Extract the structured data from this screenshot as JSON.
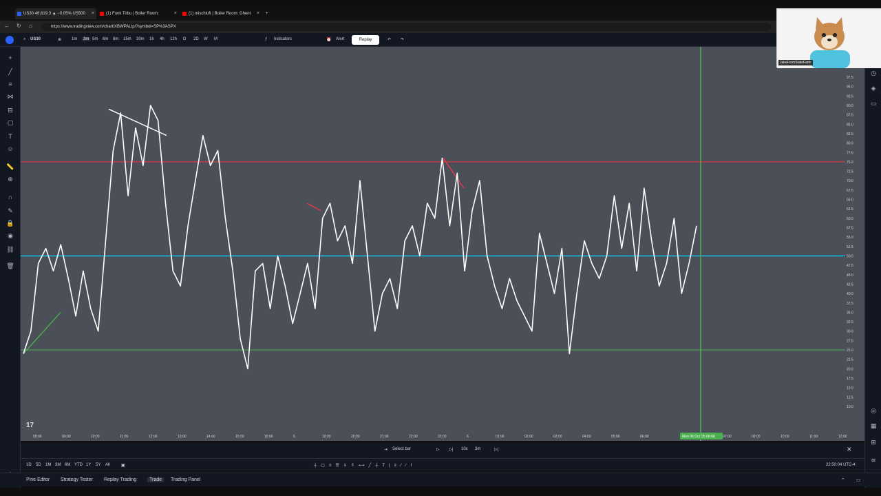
{
  "browser": {
    "tabs": [
      {
        "title": "US30 46,619.3 ▲ −0.05% US500",
        "color": "#2962ff",
        "active": true
      },
      {
        "title": "(1) Funk Tribu | Boiler Room:",
        "color": "#ff0000",
        "active": false
      },
      {
        "title": "(1) mischluft | Boiler Room: Ghent",
        "color": "#ff0000",
        "active": false
      }
    ],
    "new_tab": "+",
    "url": "https://www.tradingview.com/chart/XBWPALIp/?symbol=SP%3ASPX"
  },
  "toolbar": {
    "symbol": "US30",
    "timeframes": [
      "1m",
      "3m",
      "5m",
      "6m",
      "8m",
      "15m",
      "30m",
      "1h",
      "4h",
      "12h",
      "D",
      "2D",
      "W",
      "M"
    ],
    "selected_tf": "3m",
    "indicators_label": "Indicators",
    "alert_label": "Alert",
    "replay_label": "Replay"
  },
  "chart": {
    "x_ticks": [
      "08:00",
      "09:00",
      "10:00",
      "11:00",
      "12:00",
      "13:00",
      "14:00",
      "15:00",
      "16:00",
      "5",
      "19:00",
      "20:00",
      "21:00",
      "22:00",
      "23:00",
      "6",
      "01:00",
      "02:00",
      "03:00",
      "04:00",
      "05:00",
      "06:00",
      "07:00",
      "09:00",
      "10:00",
      "11:00",
      "12:00"
    ],
    "x_highlight": "Mon 06 Oct '25  08:00",
    "y_ticks": [
      "97.5",
      "95.0",
      "92.5",
      "90.0",
      "87.5",
      "85.0",
      "82.5",
      "80.0",
      "77.5",
      "75.0",
      "72.5",
      "70.0",
      "67.5",
      "65.0",
      "62.5",
      "60.0",
      "57.5",
      "55.0",
      "52.5",
      "50.0",
      "47.5",
      "45.0",
      "42.5",
      "40.0",
      "37.5",
      "35.0",
      "32.5",
      "30.0",
      "27.5",
      "25.0",
      "22.5",
      "20.0",
      "17.5",
      "15.0",
      "12.5",
      "10.0"
    ],
    "line_red_value": 75,
    "line_blue_value": 50,
    "line_green_value": 25,
    "colors": {
      "bg": "#4b4f58",
      "series": "#ffffff",
      "red": "#f23645",
      "blue": "#00bcd4",
      "green": "#4caf50"
    }
  },
  "chart_data": {
    "type": "line",
    "series": [
      {
        "values": [
          24,
          30,
          48,
          52,
          46,
          53,
          44,
          34,
          46,
          36,
          30,
          54,
          78,
          88,
          66,
          84,
          74,
          90,
          86,
          64,
          46,
          42,
          58,
          70,
          82,
          74,
          78,
          60,
          46,
          28,
          20,
          46,
          48,
          36,
          50,
          42,
          32,
          40,
          48,
          36,
          60,
          64,
          54,
          58,
          48,
          70,
          50,
          30,
          40,
          44,
          36,
          54,
          58,
          50,
          64,
          60,
          76,
          58,
          72,
          46,
          62,
          70,
          50,
          42,
          36,
          44,
          38,
          34,
          30,
          56,
          48,
          40,
          52,
          24,
          40,
          54,
          48,
          44,
          50,
          66,
          52,
          64,
          46,
          68,
          54,
          42,
          48,
          60,
          40,
          48,
          58
        ]
      }
    ],
    "ylim": [
      10,
      97.5
    ],
    "grid": false
  },
  "replay": {
    "select_bar": "Select bar",
    "speed": "10x",
    "interval": "3m"
  },
  "bottom": {
    "ranges": [
      "1D",
      "5D",
      "1M",
      "3M",
      "6M",
      "YTD",
      "1Y",
      "5Y",
      "All"
    ],
    "time": "22:50:04 UTC-4"
  },
  "panels": [
    "Pine Editor",
    "Strategy Tester",
    "Replay Trading",
    "Trade",
    "Trading Panel"
  ],
  "webcam": {
    "name": "JakeFromStateFarm"
  }
}
